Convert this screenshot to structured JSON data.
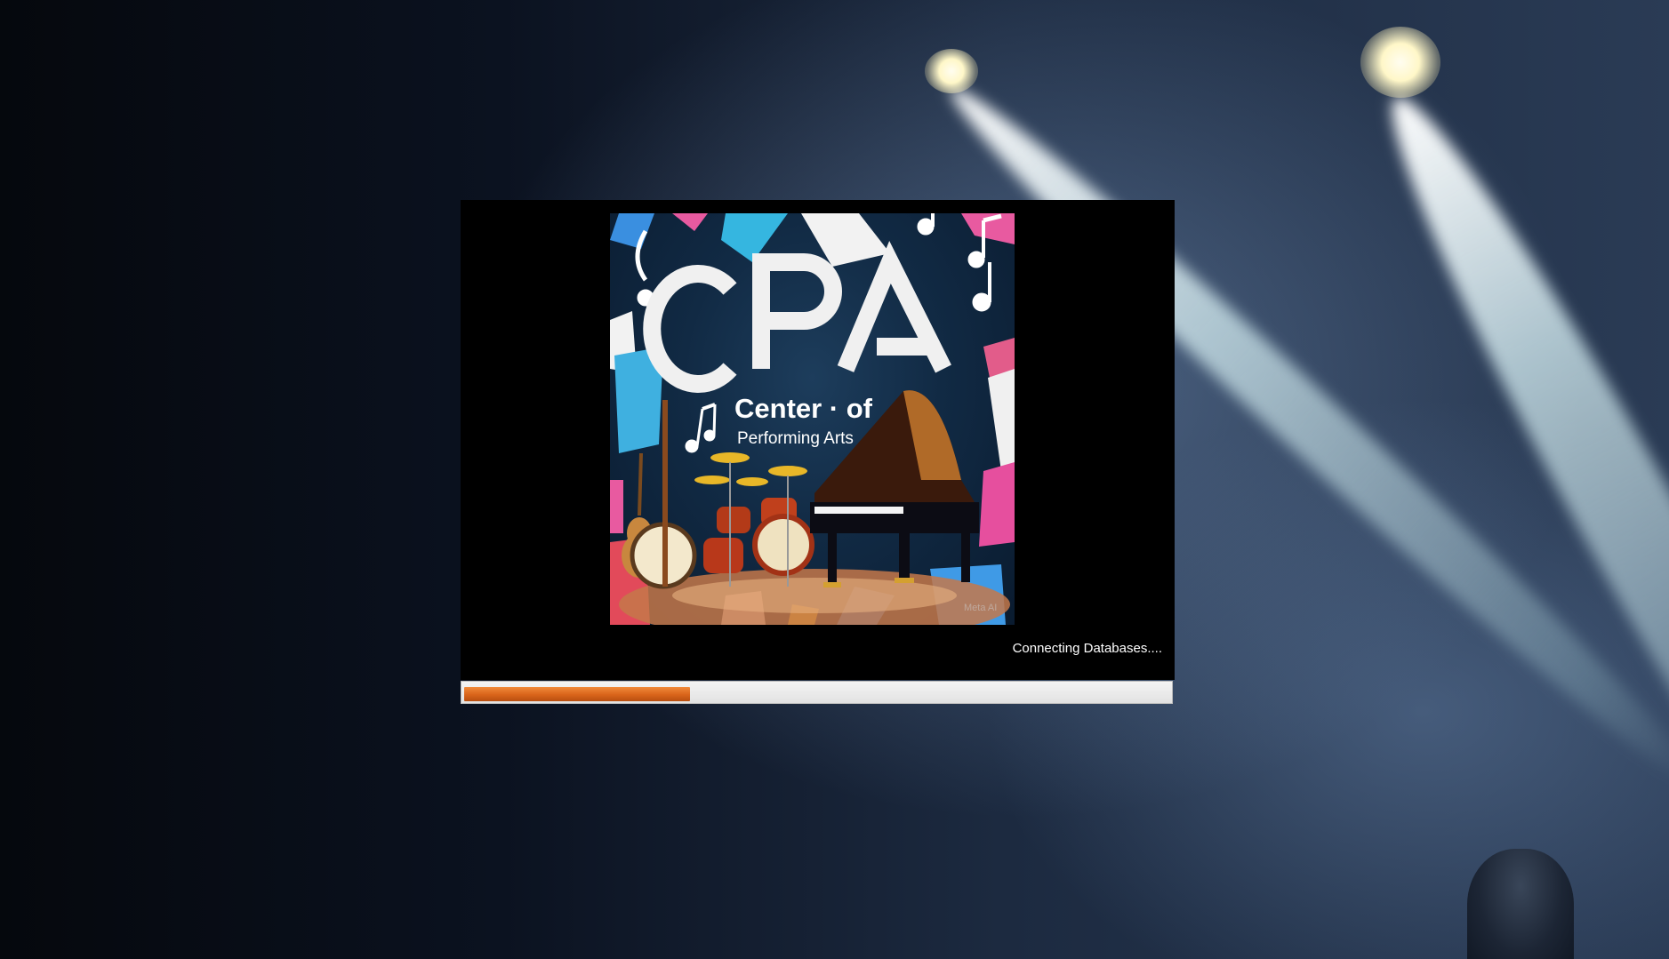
{
  "splash": {
    "logo": {
      "title": "CPA",
      "subtitle_line1": "Center · of",
      "subtitle_line2": "Performing Arts",
      "watermark": "Meta AI"
    },
    "status_text": "Connecting Databases....",
    "progress": {
      "fraction": 0.32,
      "color": "#d9641a"
    }
  },
  "colors": {
    "splash_background": "#000000",
    "progress_track": "#e8e8e8",
    "progress_fill": "#d9641a"
  }
}
